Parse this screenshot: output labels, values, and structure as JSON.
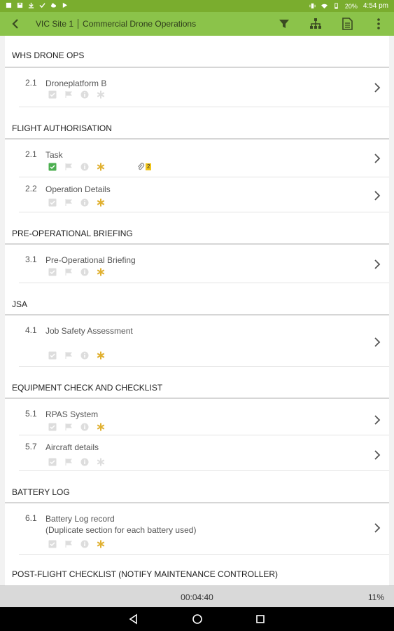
{
  "status": {
    "battery": "20%",
    "time": "4:54 pm"
  },
  "header": {
    "site": "VIC Site 1",
    "title": "Commercial Drone Operations"
  },
  "sections": {
    "whs": {
      "title": "WHS DRONE OPS",
      "items": [
        {
          "num": "2.1",
          "label": "Droneplatform B"
        }
      ]
    },
    "flight": {
      "title": "FLIGHT AUTHORISATION",
      "items": [
        {
          "num": "2.1",
          "label": "Task",
          "attachments": "2"
        },
        {
          "num": "2.2",
          "label": "Operation Details"
        }
      ]
    },
    "preop": {
      "title": "PRE-OPERATIONAL BRIEFING",
      "items": [
        {
          "num": "3.1",
          "label": "Pre-Operational Briefing"
        }
      ]
    },
    "jsa": {
      "title": "JSA",
      "items": [
        {
          "num": "4.1",
          "label": "Job Safety Assessment"
        }
      ]
    },
    "equip": {
      "title": "EQUIPMENT CHECK AND CHECKLIST",
      "items": [
        {
          "num": "5.1",
          "label": "RPAS System"
        },
        {
          "num": "5.7",
          "label": "Aircraft details"
        }
      ]
    },
    "battery": {
      "title": "BATTERY LOG",
      "items": [
        {
          "num": "6.1",
          "label": "Battery Log record",
          "label2": "(Duplicate section for each battery used)"
        }
      ]
    },
    "postflight": {
      "title": "POST-FLIGHT CHECKLIST (NOTIFY MAINTENANCE CONTROLLER)"
    }
  },
  "footer": {
    "timer": "00:04:40",
    "progress": "11%"
  },
  "colors": {
    "appbar": "#8bc34a",
    "statusbar": "#7aad2e",
    "required": "#e0b030",
    "done": "#4caf50"
  }
}
